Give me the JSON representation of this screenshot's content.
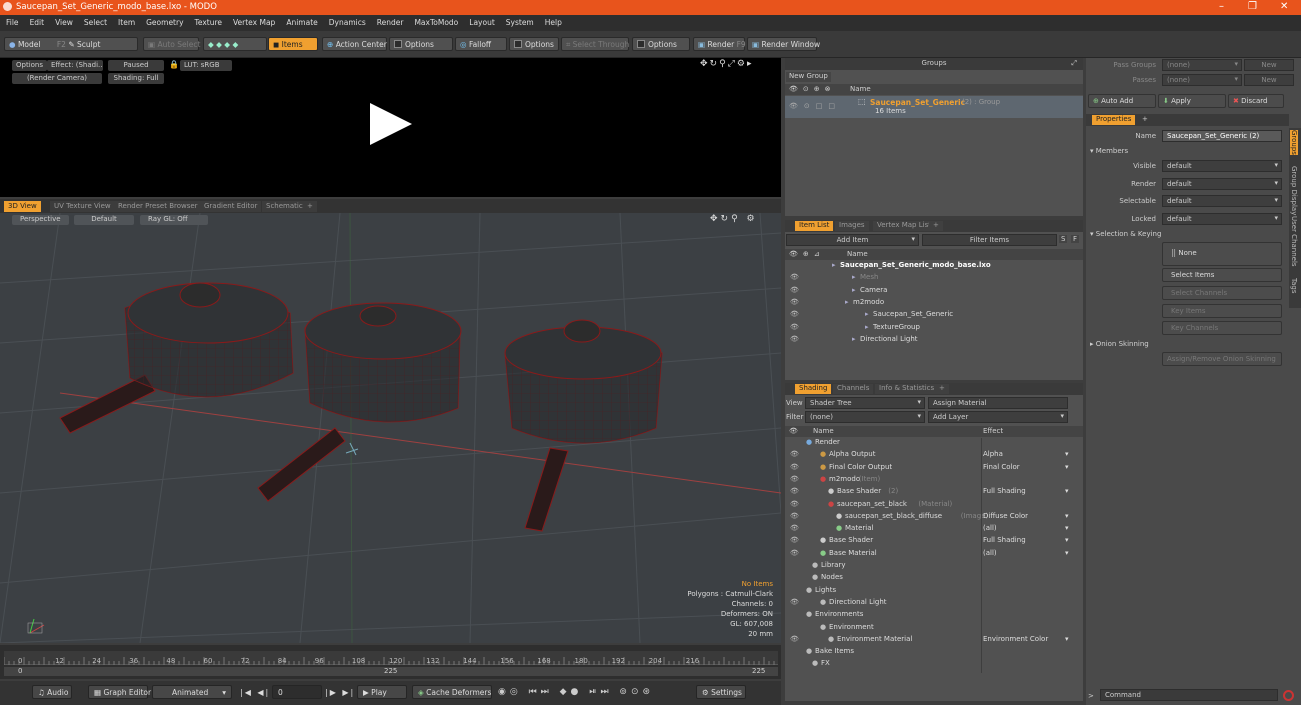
{
  "window": {
    "title": "Saucepan_Set_Generic_modo_base.lxo - MODO",
    "min": "–",
    "max": "❐",
    "close": "✕"
  },
  "menu": [
    "File",
    "Edit",
    "View",
    "Select",
    "Item",
    "Geometry",
    "Texture",
    "Vertex Map",
    "Animate",
    "Dynamics",
    "Render",
    "MaxToModo",
    "Layout",
    "System",
    "Help"
  ],
  "toolbar": {
    "model": "Model",
    "f2": "F2",
    "sculpt": "Sculpt",
    "auto_select": "Auto Select",
    "items": "Items",
    "action_center": "Action Center",
    "options1": "Options",
    "falloff": "Falloff",
    "options2": "Options",
    "select_through": "Select Through",
    "options3": "Options",
    "render": "Render",
    "f9": "F9",
    "render_window": "Render Window"
  },
  "preview": {
    "options": "Options",
    "effect": "Effect: (Shadi...",
    "paused": "Paused",
    "lut": "LUT: sRGB",
    "camera": "(Render Camera)",
    "shading": "Shading: Full"
  },
  "viewport_tabs": [
    "3D View",
    "UV Texture View",
    "Render Preset Browser",
    "Gradient Editor",
    "Schematic",
    "+"
  ],
  "viewport": {
    "perspective": "Perspective",
    "default": "Default",
    "raygl": "Ray GL: Off",
    "stats": [
      "No Items",
      "Polygons : Catmull-Clark",
      "Channels: 0",
      "Deformers: ON",
      "GL: 607,008",
      "20 mm"
    ]
  },
  "timeline": {
    "ticks": [
      "0",
      "12",
      "24",
      "36",
      "48",
      "60",
      "72",
      "84",
      "96",
      "108",
      "120",
      "132",
      "144",
      "156",
      "168",
      "180",
      "192",
      "204",
      "216"
    ],
    "start": "0",
    "mid": "225",
    "end": "225"
  },
  "bottom": {
    "audio": "Audio",
    "graph_editor": "Graph Editor",
    "animated": "Animated",
    "frame": "0",
    "play": "Play",
    "cache": "Cache Deformers",
    "settings": "Settings"
  },
  "groups": {
    "title": "Groups",
    "new_group": "New Group",
    "name_col": "Name",
    "item_name": "Saucepan_Set_Generic",
    "item_suffix": "(2) : Group",
    "item_count": "16 Items"
  },
  "item_list": {
    "tabs": [
      "Item List",
      "Images",
      "Vertex Map List",
      "+"
    ],
    "add_item": "Add Item",
    "filter": "Filter Items",
    "s": "S",
    "f": "F",
    "name_col": "Name",
    "rows": [
      {
        "label": "Saucepan_Set_Generic_modo_base.lxo",
        "indent": 55,
        "bold": true,
        "eye": ""
      },
      {
        "label": "Mesh",
        "indent": 75,
        "dim": true,
        "eye": "👁"
      },
      {
        "label": "Camera",
        "indent": 75,
        "eye": "👁"
      },
      {
        "label": "m2modo",
        "indent": 68,
        "eye": "👁"
      },
      {
        "label": "Saucepan_Set_Generic",
        "indent": 88,
        "eye": "👁"
      },
      {
        "label": "TextureGroup",
        "indent": 88,
        "eye": "👁"
      },
      {
        "label": "Directional Light",
        "indent": 75,
        "eye": "👁"
      }
    ]
  },
  "shading": {
    "tabs": [
      "Shading",
      "Channels",
      "Info & Statistics",
      "+"
    ],
    "view_label": "View",
    "view_value": "Shader Tree",
    "assign_material": "Assign Material",
    "filter_label": "Filter",
    "filter_value": "(none)",
    "add_layer": "Add Layer",
    "name_col": "Name",
    "effect_col": "Effect",
    "rows": [
      {
        "label": "Render",
        "sub": "",
        "effect": "",
        "indent": 30
      },
      {
        "label": "Alpha Output",
        "sub": "",
        "effect": "Alpha",
        "indent": 44
      },
      {
        "label": "Final Color Output",
        "sub": "",
        "effect": "Final Color",
        "indent": 44
      },
      {
        "label": "m2modo",
        "sub": "(Item)",
        "effect": "",
        "indent": 44
      },
      {
        "label": "Base Shader",
        "sub": "(2)",
        "effect": "Full Shading",
        "indent": 52
      },
      {
        "label": "saucepan_set_black",
        "sub": "(Material)",
        "effect": "",
        "indent": 52
      },
      {
        "label": "saucepan_set_black_diffuse",
        "sub": "(Image)",
        "effect": "Diffuse Color",
        "indent": 60
      },
      {
        "label": "Material",
        "sub": "",
        "effect": "(all)",
        "indent": 60
      },
      {
        "label": "Base Shader",
        "sub": "",
        "effect": "Full Shading",
        "indent": 44
      },
      {
        "label": "Base Material",
        "sub": "",
        "effect": "(all)",
        "indent": 44
      },
      {
        "label": "Library",
        "sub": "",
        "effect": "",
        "indent": 36
      },
      {
        "label": "Nodes",
        "sub": "",
        "effect": "",
        "indent": 36
      },
      {
        "label": "Lights",
        "sub": "",
        "effect": "",
        "indent": 30
      },
      {
        "label": "Directional Light",
        "sub": "",
        "effect": "",
        "indent": 44
      },
      {
        "label": "Environments",
        "sub": "",
        "effect": "",
        "indent": 30
      },
      {
        "label": "Environment",
        "sub": "",
        "effect": "",
        "indent": 44
      },
      {
        "label": "Environment Material",
        "sub": "",
        "effect": "Environment Color",
        "indent": 52
      },
      {
        "label": "Bake Items",
        "sub": "",
        "effect": "",
        "indent": 30
      },
      {
        "label": "FX",
        "sub": "",
        "effect": "",
        "indent": 36
      }
    ]
  },
  "right": {
    "pass_groups": "Pass Groups",
    "passes": "Passes",
    "none": "(none)",
    "new": "New",
    "auto_add": "Auto Add",
    "apply": "Apply",
    "discard": "Discard",
    "properties_tab": "Properties",
    "plus": "+",
    "name_label": "Name",
    "name_value": "Saucepan_Set_Generic (2)",
    "members": "Members",
    "props": [
      {
        "label": "Visible",
        "value": "default"
      },
      {
        "label": "Render",
        "value": "default"
      },
      {
        "label": "Selectable",
        "value": "default"
      },
      {
        "label": "Locked",
        "value": "default"
      }
    ],
    "selection_keying": "Selection & Keying",
    "none_btn": "None",
    "select_items": "Select Items",
    "select_channels": "Select Channels",
    "key_items": "Key Items",
    "key_channels": "Key Channels",
    "onion": "Onion Skinning",
    "assign_onion": "Assign/Remove Onion Skinning",
    "side_tabs": [
      "Groups",
      "Group Display",
      "User Channels",
      "Tags"
    ],
    "command": "Command"
  },
  "colors": {
    "accent": "#f0a030",
    "titlebar": "#e8541c"
  }
}
